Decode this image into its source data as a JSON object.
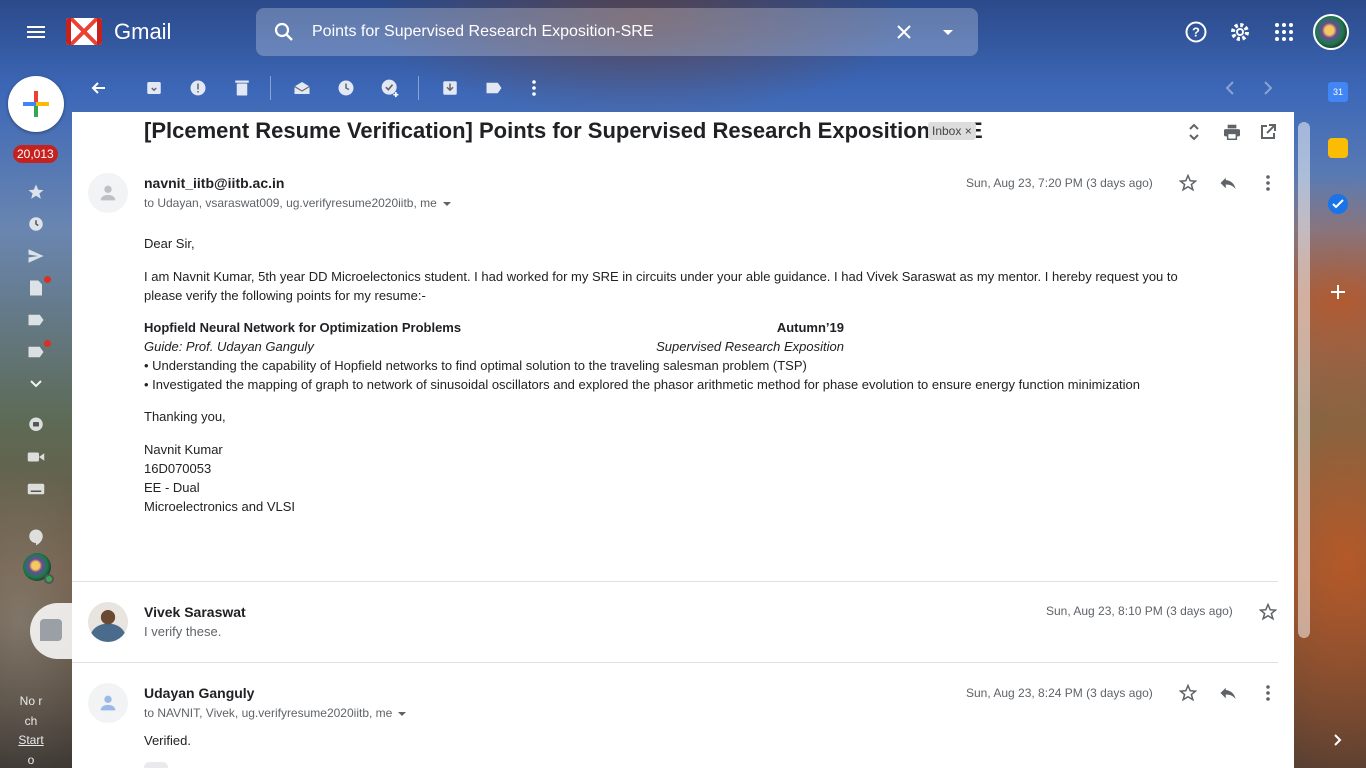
{
  "app": {
    "name": "Gmail",
    "compose_tooltip": "Compose",
    "unread_count": "20,013"
  },
  "search": {
    "value": "Points for Supervised Research Exposition-SRE"
  },
  "thread": {
    "subject": "[Plcement Resume Verification] Points for Supervised Research Exposition-SRE",
    "label_chip": "Inbox ×"
  },
  "messages": [
    {
      "sender": "navnit_iitb@iitb.ac.in",
      "recipients": "to Udayan, vsaraswat009, ug.verifyresume2020iitb, me",
      "date": "Sun, Aug 23, 7:20 PM (3 days ago)",
      "greeting": "Dear Sir,",
      "para1": "I am Navnit Kumar, 5th year DD Microelectonics student. I had worked for my SRE in circuits under your able guidance. I had Vivek Saraswat as my mentor. I hereby request you to",
      "para2": "please verify the following points for my resume:-",
      "project_title": "Hopfield Neural Network for Optimization Problems",
      "project_term": "Autumn’19",
      "project_guide": "Guide: Prof. Udayan Ganguly",
      "project_type": "Supervised Research Exposition",
      "bullet1": "• Understanding the capability of Hopfield networks to find optimal solution to the traveling salesman problem (TSP)",
      "bullet2": "• Investigated the mapping of graph to network of sinusoidal oscillators and explored the phasor arithmetic method for phase evolution to ensure energy function minimization",
      "closing": "Thanking you,",
      "sig_name": "Navnit Kumar",
      "sig_roll": "16D070053",
      "sig_dept": "EE - Dual",
      "sig_branch": "Microelectronics and VLSI"
    },
    {
      "sender": "Vivek Saraswat",
      "snippet": "I verify these.",
      "date": "Sun, Aug 23, 8:10 PM (3 days ago)"
    },
    {
      "sender": "Udayan Ganguly",
      "recipients": "to NAVNIT, Vivek, ug.verifyresume2020iitb, me",
      "date": "Sun, Aug 23, 8:24 PM (3 days ago)",
      "body": "Verified."
    }
  ],
  "left_rail_note": [
    "No r",
    "ch",
    "Start",
    "o"
  ],
  "right_rail": {
    "calendar_day": "31"
  }
}
